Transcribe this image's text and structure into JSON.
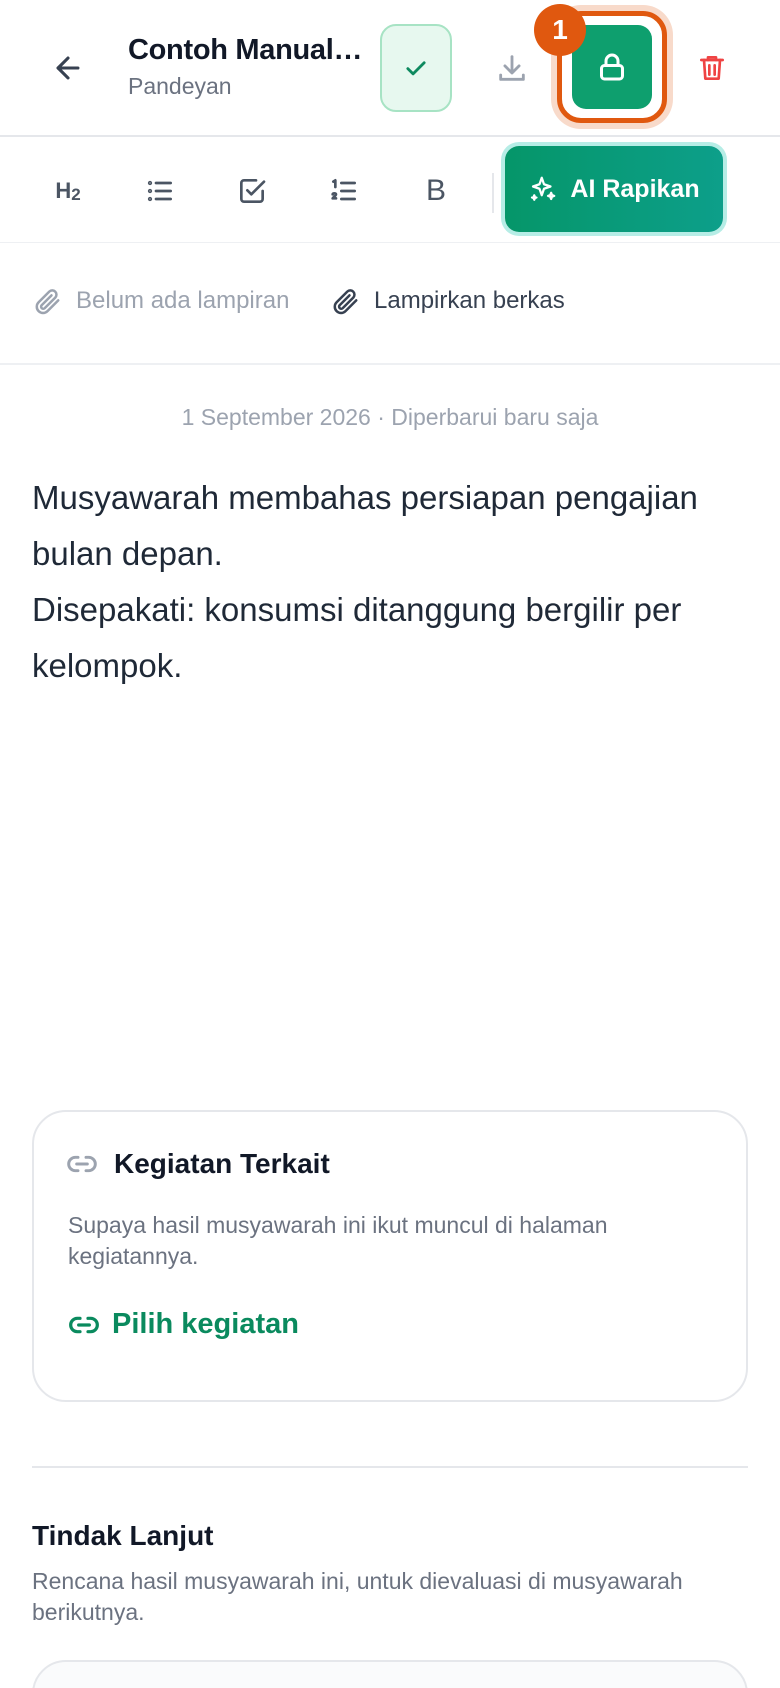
{
  "header": {
    "title": "Contoh Manual ...",
    "subtitle": "Pandeyan",
    "step_badge": "1",
    "icons": {
      "back": "arrow-left-icon",
      "save": "check-icon",
      "download": "download-icon",
      "lock": "lock-icon",
      "delete": "trash-icon"
    },
    "colors": {
      "accent_green": "#0e9f6e",
      "highlight_orange": "#e0580f",
      "delete_red": "#ef4444"
    }
  },
  "toolbar": {
    "heading_label": "H",
    "heading_level": "2",
    "tools": [
      "heading-2-icon",
      "bullet-list-icon",
      "checkbox-icon",
      "numbered-list-icon",
      "bold-icon"
    ],
    "bold_label": "B",
    "ai_button_label": "AI Rapikan",
    "ai_icon": "sparkles-icon"
  },
  "attachments": {
    "empty_label": "Belum ada lampiran",
    "attach_label": "Lampirkan berkas",
    "icon": "paperclip-icon"
  },
  "note": {
    "meta": "1 September 2026 · Diperbarui baru saja",
    "lines": [
      "Musyawarah membahas persiapan pengajian bulan depan.",
      "Disepakati: konsumsi ditanggung bergilir per kelompok."
    ]
  },
  "related": {
    "title": "Kegiatan Terkait",
    "description": "Supaya hasil musyawarah ini ikut muncul di halaman kegiatannya.",
    "link_label": "Pilih kegiatan",
    "icon": "link-icon"
  },
  "follow_up": {
    "title": "Tindak Lanjut",
    "description": "Rencana hasil musyawarah ini, untuk dievaluasi di musyawarah berikutnya."
  }
}
